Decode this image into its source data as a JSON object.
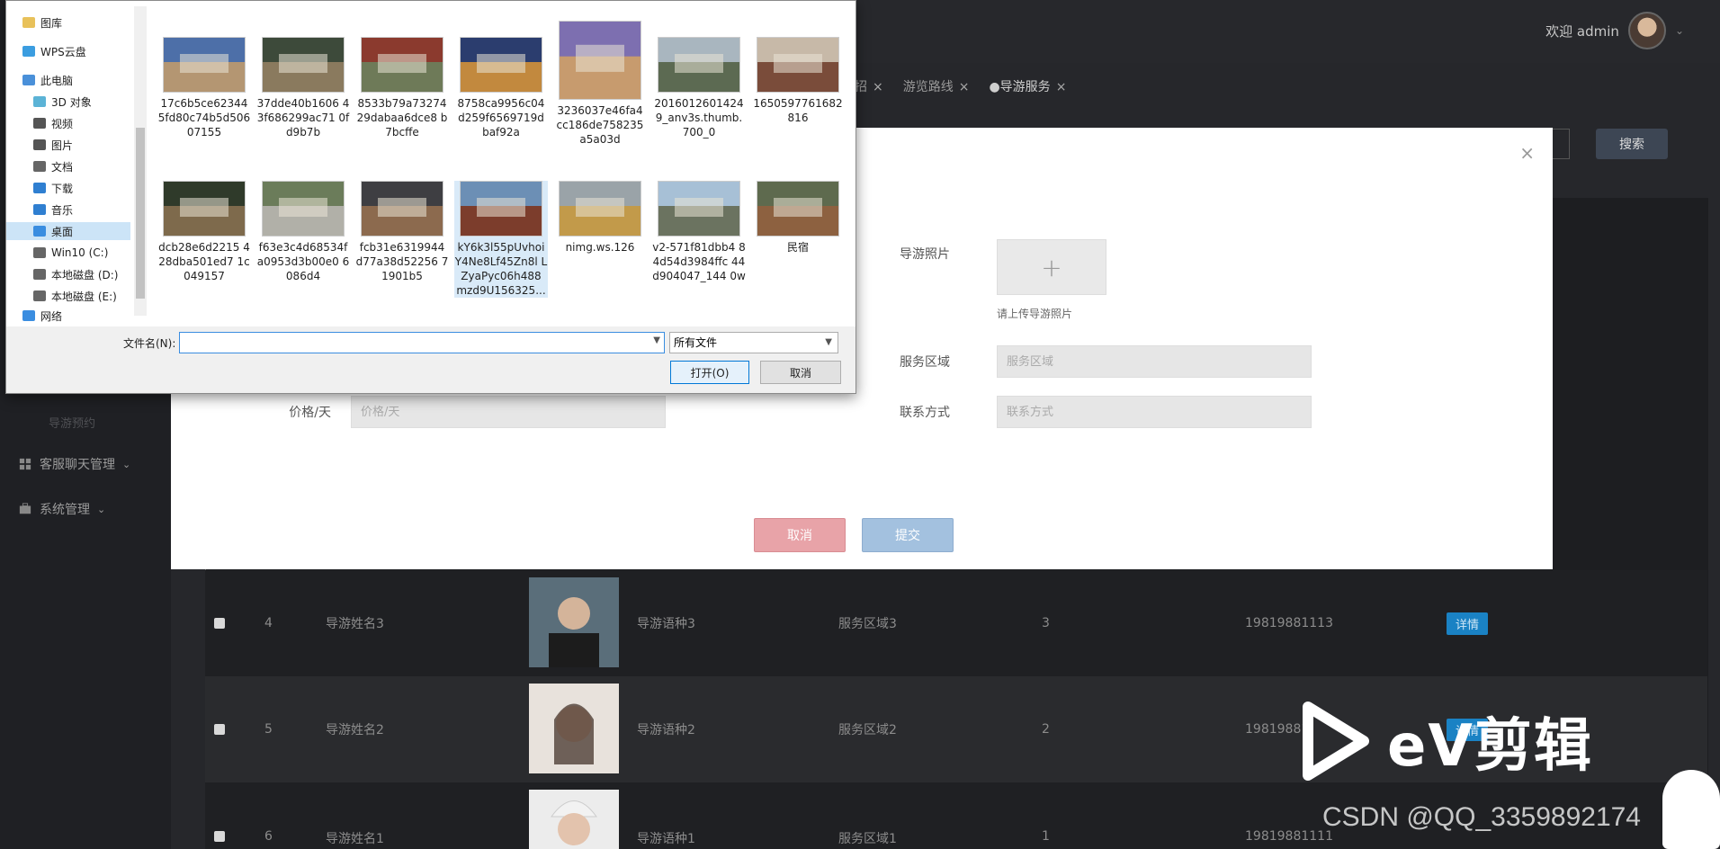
{
  "header": {
    "welcome": "欢迎 admin",
    "search_label": "搜索"
  },
  "tabs": [
    {
      "label": "招",
      "active": false
    },
    {
      "label": "游览路线",
      "active": false
    },
    {
      "label": "●导游服务",
      "active": true
    }
  ],
  "sidebar": {
    "faded_item": "导游预约",
    "items": [
      {
        "label": "客服聊天管理"
      },
      {
        "label": "系统管理"
      }
    ]
  },
  "table": {
    "rows": [
      {
        "index": "4",
        "name": "导游姓名3",
        "language": "导游语种3",
        "area": "服务区域3",
        "count": "3",
        "phone": "19819881113",
        "action": "详情"
      },
      {
        "index": "5",
        "name": "导游姓名2",
        "language": "导游语种2",
        "area": "服务区域2",
        "count": "2",
        "phone": "19819881",
        "action": "详情"
      },
      {
        "index": "6",
        "name": "导游姓名1",
        "language": "导游语种1",
        "area": "服务区域1",
        "count": "1",
        "phone": "19819881111",
        "action": "详情"
      }
    ]
  },
  "modal": {
    "photo_label": "导游照片",
    "upload_hint": "请上传导游照片",
    "area_label": "服务区域",
    "area_placeholder": "服务区域",
    "price_label": "价格/天",
    "price_placeholder": "价格/天",
    "contact_label": "联系方式",
    "contact_placeholder": "联系方式",
    "cancel": "取消",
    "submit": "提交"
  },
  "file_dialog": {
    "nav": [
      {
        "label": "图库",
        "icon": "folder-icon"
      },
      {
        "label": "WPS云盘",
        "icon": "cloud-icon"
      },
      {
        "label": "此电脑",
        "icon": "computer-icon"
      },
      {
        "label": "3D 对象",
        "icon": "cube-icon"
      },
      {
        "label": "视频",
        "icon": "video-icon"
      },
      {
        "label": "图片",
        "icon": "picture-icon"
      },
      {
        "label": "文档",
        "icon": "document-icon"
      },
      {
        "label": "下载",
        "icon": "download-icon"
      },
      {
        "label": "音乐",
        "icon": "music-icon"
      },
      {
        "label": "桌面",
        "icon": "desktop-icon",
        "selected": true
      },
      {
        "label": "Win10 (C:)",
        "icon": "drive-icon"
      },
      {
        "label": "本地磁盘 (D:)",
        "icon": "drive-icon"
      },
      {
        "label": "本地磁盘 (E:)",
        "icon": "drive-icon"
      },
      {
        "label": "网络",
        "icon": "network-icon"
      }
    ],
    "files": [
      {
        "name": "17c6b5ce623445fd80c74b5d50607155",
        "c1": "#4d6fa8",
        "c2": "#b49672"
      },
      {
        "name": "37dde40b1606 43f686299ac71 0fd9b7b",
        "c1": "#3d4a3a",
        "c2": "#8a7a5e"
      },
      {
        "name": "8533b79a73274 29dabaa6dce8 b7bcffe",
        "c1": "#8b3a2e",
        "c2": "#6e7a58"
      },
      {
        "name": "8758ca9956c04 d259f6569719d baf92a",
        "c1": "#2b3d6e",
        "c2": "#c2893e"
      },
      {
        "name": "3236037e46fa4 cc186de758235 a5a03d",
        "c1": "#7d6fb0",
        "c2": "#c79b6e"
      },
      {
        "name": "2016012601424 9_anv3s.thumb. 700_0",
        "c1": "#a9b6bf",
        "c2": "#5c6a52"
      },
      {
        "name": "1650597761682 816",
        "c1": "#c7b9a8",
        "c2": "#7a4c3a"
      },
      {
        "name": "dcb28e6d2215 428dba501ed7 1c049157",
        "c1": "#2f3a2a",
        "c2": "#7e6a4c"
      },
      {
        "name": "f63e3c4d68534f a0953d3b00e0 6086d4",
        "c1": "#6b7c5a",
        "c2": "#b1b0a8"
      },
      {
        "name": "fcb31e6319944 d77a38d52256 71901b5",
        "c1": "#3e3e42",
        "c2": "#8c6a4e"
      },
      {
        "name": "kY6k3l55pUvhoi Y4Ne8Lf45Zn8l LZyaPyc06h488 mzd9U156325...",
        "c1": "#6c8fb5",
        "c2": "#7c3d2c",
        "selected": true
      },
      {
        "name": "nimg.ws.126",
        "c1": "#9aa3a8",
        "c2": "#c29a4a"
      },
      {
        "name": "v2-571f81dbb4 84d54d3984ffc 44d904047_144 0w",
        "c1": "#a7c0d6",
        "c2": "#6b7360"
      },
      {
        "name": "民宿",
        "c1": "#5e6a4e",
        "c2": "#8d6140"
      }
    ],
    "filename_label": "文件名(N):",
    "filename_value": "",
    "filetype": "所有文件",
    "open": "打开(O)",
    "cancel": "取消"
  },
  "watermark": {
    "ev": "eV剪辑",
    "csdn": "CSDN @QQ_3359892174"
  }
}
